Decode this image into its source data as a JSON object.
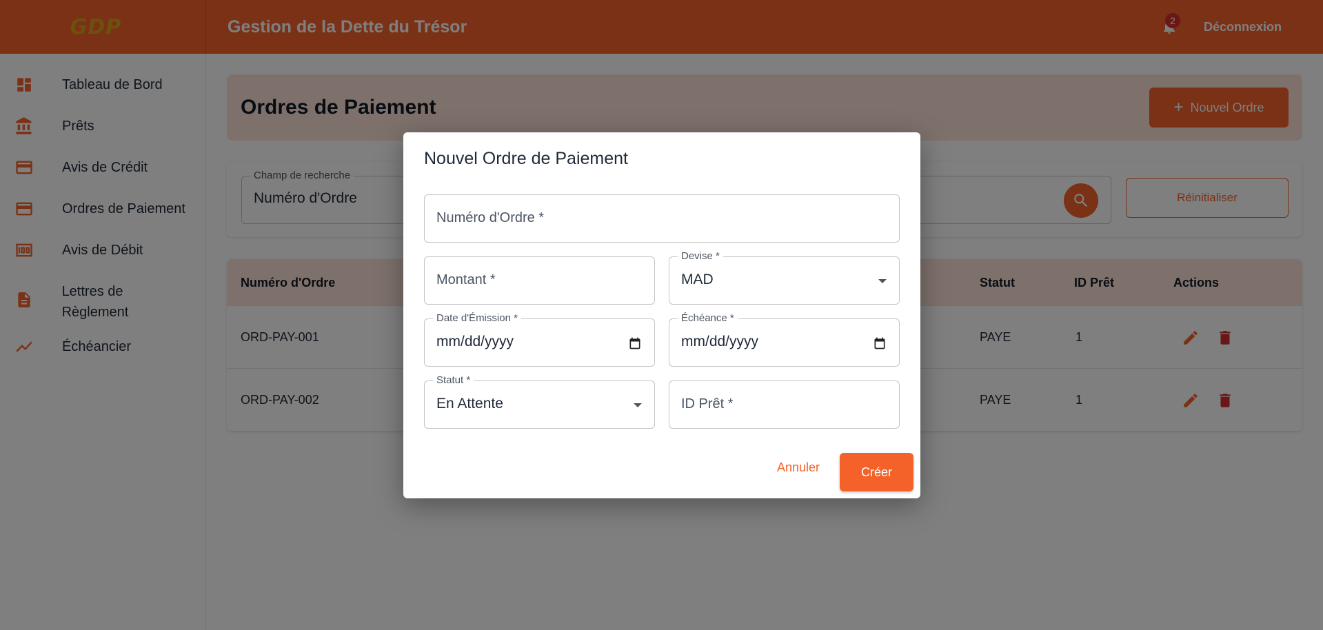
{
  "header": {
    "logo": "GDP",
    "title": "Gestion de la Dette du Trésor",
    "notification_count": "2",
    "logout_label": "Déconnexion"
  },
  "sidebar": {
    "items": [
      {
        "label": "Tableau de Bord",
        "icon": "dashboard-icon"
      },
      {
        "label": "Prêts",
        "icon": "bank-icon"
      },
      {
        "label": "Avis de Crédit",
        "icon": "credit-card-icon"
      },
      {
        "label": "Ordres de Paiement",
        "icon": "credit-card-icon"
      },
      {
        "label": "Avis de Débit",
        "icon": "money-icon"
      },
      {
        "label": "Lettres de Règlement",
        "icon": "document-icon"
      },
      {
        "label": "Échéancier",
        "icon": "trending-icon"
      }
    ]
  },
  "page": {
    "title": "Ordres de Paiement",
    "new_button": "Nouvel Ordre",
    "search": {
      "legend": "Champ de recherche",
      "value": "Numéro d'Ordre"
    },
    "reset_button": "Réinitialiser"
  },
  "table": {
    "columns": [
      "Numéro d'Ordre",
      "Statut",
      "ID Prêt",
      "Actions"
    ],
    "rows": [
      {
        "numero": "ORD-PAY-001",
        "statut": "PAYE",
        "id_pret": "1"
      },
      {
        "numero": "ORD-PAY-002",
        "statut": "PAYE",
        "id_pret": "1"
      }
    ]
  },
  "dialog": {
    "title": "Nouvel Ordre de Paiement",
    "numero_label": "Numéro d'Ordre *",
    "montant_label": "Montant *",
    "devise_label": "Devise *",
    "devise_value": "MAD",
    "date_emission_label": "Date d'Émission *",
    "date_emission_value": "mm/dd/yyyy",
    "echeance_label": "Échéance *",
    "echeance_value": "mm/dd/yyyy",
    "statut_label": "Statut *",
    "statut_value": "En Attente",
    "id_pret_label": "ID Prêt *",
    "cancel_button": "Annuler",
    "create_button": "Créer"
  },
  "colors": {
    "accent": "#f4622a",
    "accent_light": "#fde3d8",
    "logo": "#d6a21a"
  }
}
